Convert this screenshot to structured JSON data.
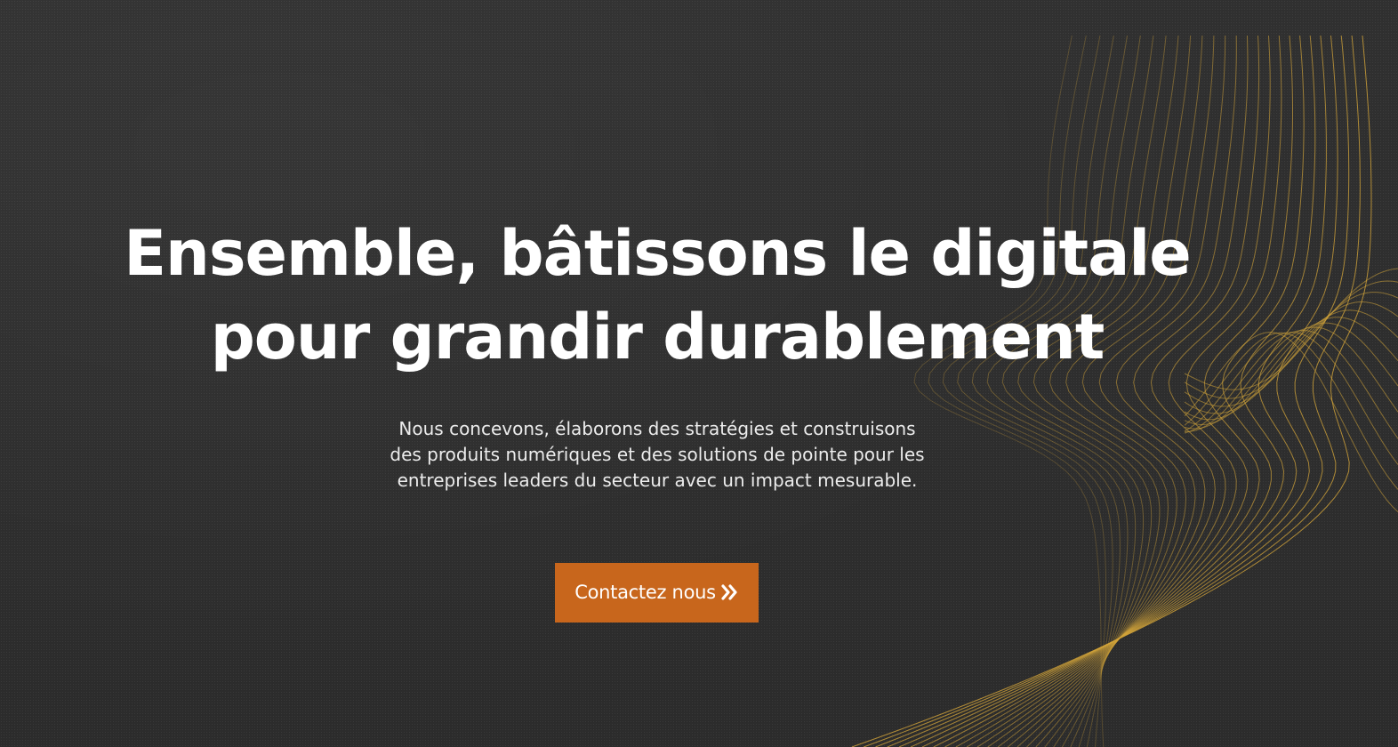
{
  "hero": {
    "headline_line1": "Ensemble, bâtissons le digitale",
    "headline_line2": "pour grandir durablement",
    "subtitle_line1": "Nous concevons, élaborons des stratégies et construisons",
    "subtitle_line2": "des produits numériques et des solutions de pointe pour les",
    "subtitle_line3": "entreprises leaders du secteur avec un impact mesurable.",
    "cta_label": "Contactez nous",
    "cta_icon": "double-chevron-right-icon"
  },
  "colors": {
    "background": "#2f2f2f",
    "accent": "#c8661c",
    "wave_lines": "#d4a53a",
    "text": "#ffffff"
  },
  "decor": {
    "wave_icon": "wave-lines-decoration"
  }
}
